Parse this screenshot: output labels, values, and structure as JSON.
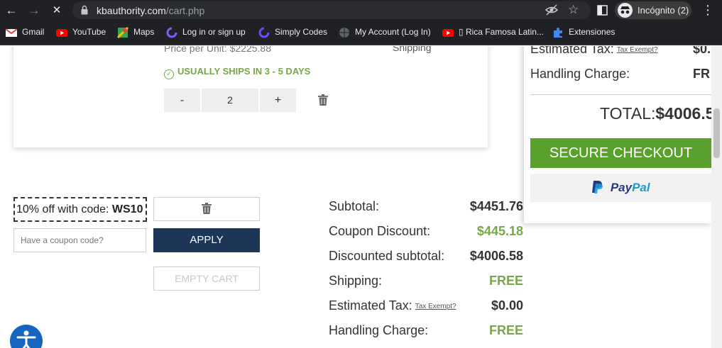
{
  "browser": {
    "url_domain": "kbauthority.com",
    "url_path": "/cart.php",
    "incognito_label": "Incógnito (2)",
    "bookmarks": [
      {
        "label": "Gmail",
        "icon": "gmail-icon"
      },
      {
        "label": "YouTube",
        "icon": "youtube-icon"
      },
      {
        "label": "Maps",
        "icon": "maps-icon"
      },
      {
        "label": "Log in or sign up",
        "icon": "login-icon"
      },
      {
        "label": "Simply Codes",
        "icon": "simplycodes-icon"
      },
      {
        "label": "My Account (Log In)",
        "icon": "globe-icon"
      },
      {
        "label": "▯ Rica Famosa Latin...",
        "icon": "youtube-icon"
      },
      {
        "label": "Extensiones",
        "icon": "puzzle-icon"
      }
    ]
  },
  "item": {
    "price_unit": "Price per Unit: $2225.88",
    "ships": "USUALLY SHIPS IN 3 - 5 DAYS",
    "qty_minus": "-",
    "qty_value": "2",
    "qty_plus": "+",
    "shipping_label": "Shipping"
  },
  "coupon": {
    "tag_prefix": "10% off with code: ",
    "tag_code": "WS10",
    "placeholder": "Have a coupon code?",
    "apply_label": "APPLY",
    "empty_label": "EMPTY CART"
  },
  "totals": {
    "subtotal_label": "Subtotal:",
    "subtotal": "$4451.76",
    "coupon_label": "Coupon Discount:",
    "coupon": "$445.18",
    "discounted_label": "Discounted subtotal:",
    "discounted": "$4006.58",
    "shipping_label": "Shipping:",
    "shipping": "FREE",
    "tax_label": "Estimated Tax:",
    "tax_link": "Tax Exempt?",
    "tax": "$0.00",
    "handling_label": "Handling Charge:",
    "handling": "FREE"
  },
  "summary": {
    "tax_label": "Estimated Tax:",
    "tax_link": "Tax Exempt?",
    "tax": "$0.",
    "handling_label": "Handling Charge:",
    "handling": "FR",
    "total_label": "TOTAL:",
    "total": "$4006.5",
    "checkout_label": "SECURE CHECKOUT",
    "paypal_pay": "Pay",
    "paypal_pal": "Pal"
  },
  "colors": {
    "accent_green": "#7aa64a",
    "checkout_green": "#5aa02c",
    "navy": "#1d3556",
    "chrome_dark": "#202124"
  }
}
